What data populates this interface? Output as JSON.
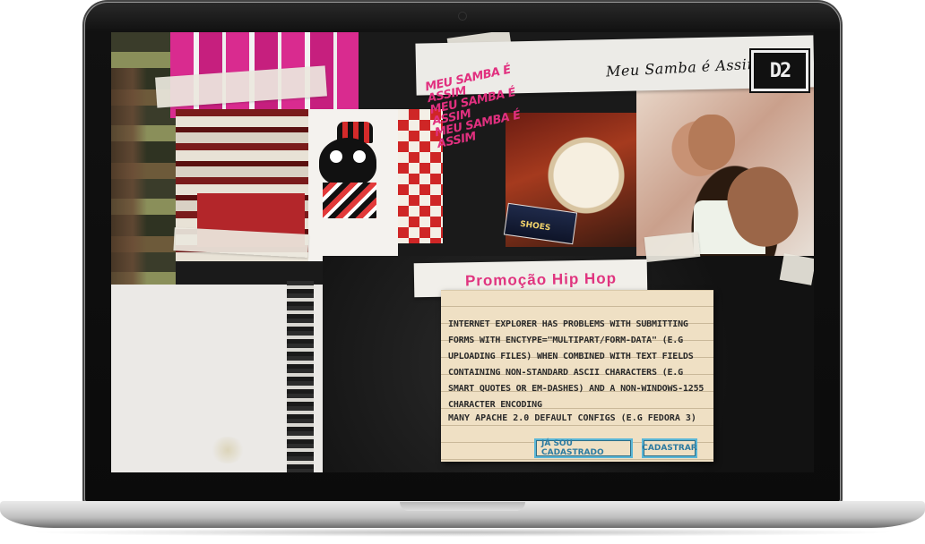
{
  "site": {
    "logo_text": "Meu Samba é Assim",
    "badge_text": "D2",
    "graffiti_lines": [
      "Meu Samba é Assim",
      "Meu Samba é Assim",
      "Meu Samba é Assim"
    ]
  },
  "promo": {
    "title": "Promoção Hip Hop"
  },
  "notice": {
    "paragraph": "Internet Explorer has problems with submitting forms with enctype=\"multipart/form-data\" (e.g uploading files) when combined with text fields containing non-standard ASCII characters (e.g smart quotes or em-dashes) and a non-windows-1255 character encoding",
    "line2": "Many Apache 2.0 default configs (e.g Fedora 3)"
  },
  "photo": {
    "shoes_label": "SHOES"
  },
  "buttons": {
    "registered": "Já sou cadastrado",
    "register": "Cadastrar"
  }
}
